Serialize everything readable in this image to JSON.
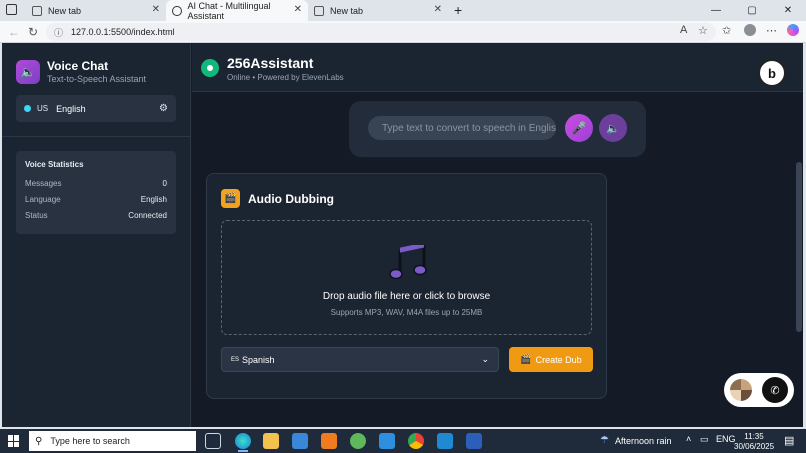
{
  "browser": {
    "tabs": [
      {
        "title": "New tab",
        "active": false
      },
      {
        "title": "AI Chat - Multilingual Assistant",
        "active": true
      },
      {
        "title": "New tab",
        "active": false
      }
    ],
    "new_tab_glyph": "+",
    "url": "127.0.0.1:5500/index.html"
  },
  "sidebar": {
    "brand_title": "Voice Chat",
    "brand_subtitle": "Text-to-Speech Assistant",
    "language": {
      "code": "US",
      "name": "English"
    },
    "stats": {
      "title": "Voice Statistics",
      "rows": [
        {
          "label": "Messages",
          "value": "0"
        },
        {
          "label": "Language",
          "value": "English"
        },
        {
          "label": "Status",
          "value": "Connected"
        }
      ]
    }
  },
  "header": {
    "assistant_name": "256Assistant",
    "status_text": "Online • Powered by ElevenLabs",
    "logo_letter": "b"
  },
  "chat_input": {
    "placeholder": "Type text to convert to speech in English..."
  },
  "dubbing": {
    "title": "Audio Dubbing",
    "drop_text": "Drop audio file here or click to browse",
    "drop_subtext": "Supports MP3, WAV, M4A files up to 25MB",
    "target_language_code": "ES",
    "target_language": "Spanish",
    "create_button": "Create Dub"
  },
  "taskbar": {
    "search_placeholder": "Type here to search",
    "weather": "Afternoon rain",
    "language": "ENG",
    "time": "11:35",
    "date": "30/06/2025"
  },
  "colors": {
    "app_bg": "#141b27",
    "panel_bg": "#1b2431",
    "accent_purple": "#b04bd9",
    "accent_orange": "#f09a13",
    "online_green": "#12b77b"
  }
}
